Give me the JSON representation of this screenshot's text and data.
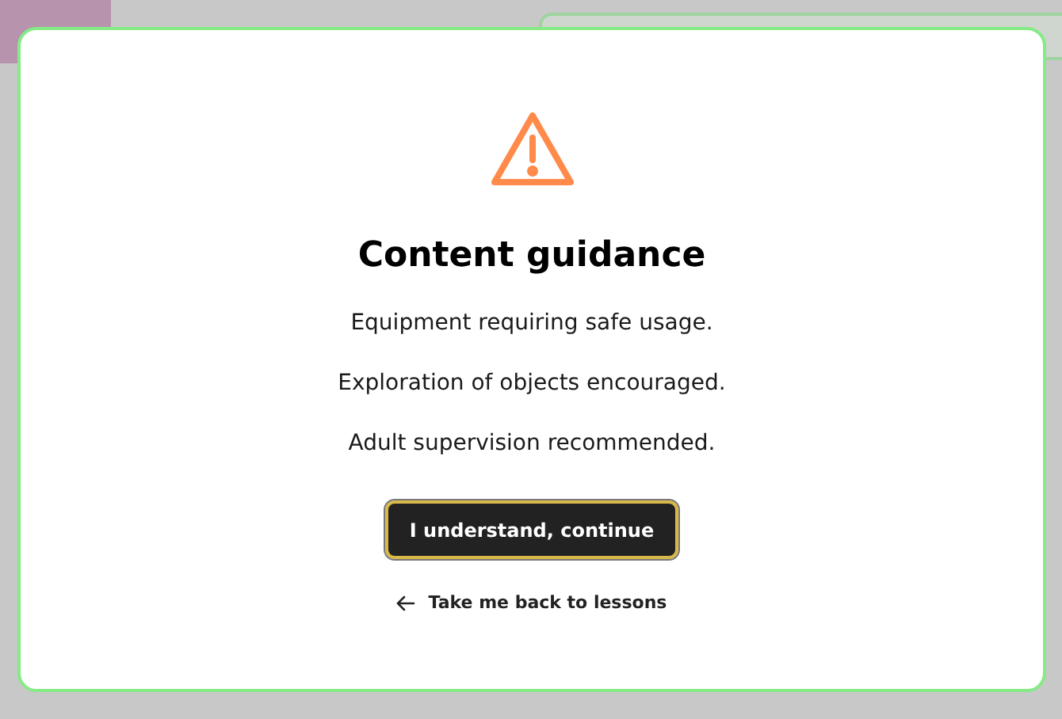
{
  "dialog": {
    "title": "Content guidance",
    "notes": [
      "Equipment requiring safe usage.",
      "Exploration of objects encouraged.",
      "Adult supervision recommended."
    ],
    "primary_button": "I understand, continue",
    "back_link": "Take me back to lessons"
  }
}
